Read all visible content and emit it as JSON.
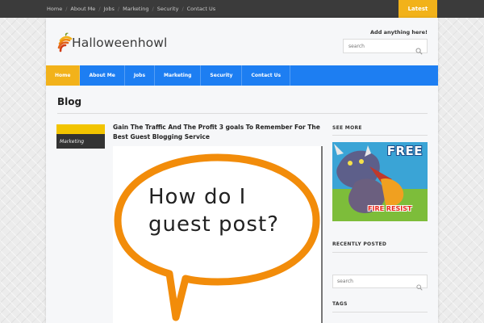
{
  "topbar": {
    "links": [
      "Home",
      "About Me",
      "Jobs",
      "Marketing",
      "Security",
      "Contact Us"
    ],
    "latest_label": "Latest"
  },
  "header": {
    "site_name": "Halloweenhowl",
    "promo_text": "Add anything here!",
    "search_placeholder": "search"
  },
  "mainnav": {
    "items": [
      "Home",
      "About Me",
      "Jobs",
      "Marketing",
      "Security",
      "Contact Us"
    ],
    "active": "Home"
  },
  "main": {
    "heading": "Blog",
    "post": {
      "category": "Marketing",
      "title": "Gain The Traffic And The Profit 3 goals To Remember For The Best Guest Blogging Service",
      "image_text_line1": "How do I",
      "image_text_line2": "guest post?"
    }
  },
  "sidebar": {
    "see_more_heading": "SEE MORE",
    "ad_text_top": "FREE",
    "ad_text_bottom": "FIRE RESIST",
    "recently_posted_heading": "RECENTLY POSTED",
    "search_placeholder": "search",
    "tags_heading": "TAGS"
  },
  "colors": {
    "accent_yellow": "#f2b21a",
    "nav_blue": "#1d7ef2",
    "topbar": "#3b3b3b",
    "bubble_orange": "#f28c0a"
  }
}
